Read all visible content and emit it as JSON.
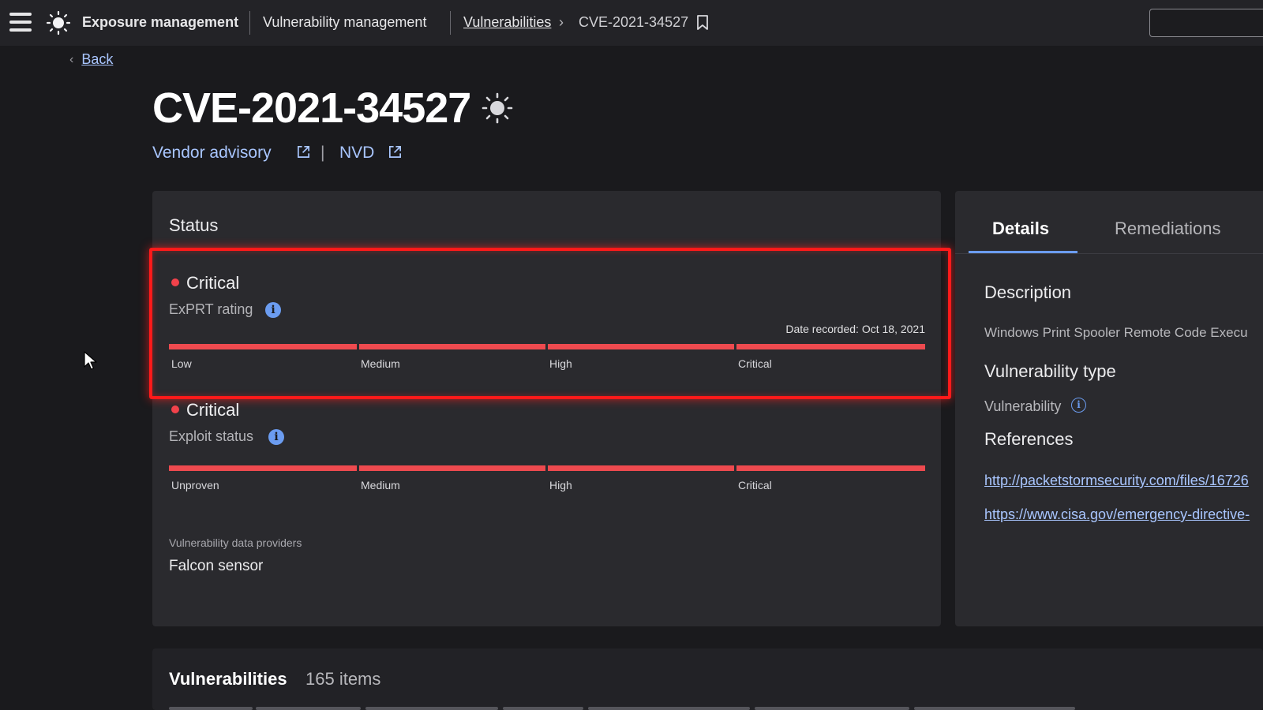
{
  "topbar": {
    "app_title": "Exposure management",
    "section": "Vulnerability management",
    "breadcrumb_link": "Vulnerabilities",
    "breadcrumb_current": "CVE-2021-34527"
  },
  "back_label": "Back",
  "cve": {
    "id": "CVE-2021-34527",
    "vendor_advisory": "Vendor advisory",
    "separator": "|",
    "nvd": "NVD"
  },
  "status": {
    "title": "Status",
    "exprt": {
      "level": "Critical",
      "label": "ExPRT rating",
      "date_recorded": "Date recorded: Oct 18, 2021",
      "scale": [
        "Low",
        "Medium",
        "High",
        "Critical"
      ]
    },
    "exploit": {
      "level": "Critical",
      "label": "Exploit status",
      "scale": [
        "Unproven",
        "Medium",
        "High",
        "Critical"
      ]
    },
    "providers_heading": "Vulnerability data providers",
    "providers_value": "Falcon sensor"
  },
  "details": {
    "tabs": [
      "Details",
      "Remediations"
    ],
    "description_heading": "Description",
    "description": "Windows Print Spooler Remote Code Execu",
    "vuln_type_heading": "Vulnerability type",
    "vuln_type": "Vulnerability",
    "references_heading": "References",
    "references": [
      "http://packetstormsecurity.com/files/16726",
      "https://www.cisa.gov/emergency-directive-"
    ]
  },
  "list": {
    "title": "Vulnerabilities",
    "count": "165 items"
  },
  "colors": {
    "critical": "#ee4a4f",
    "accent": "#a9c6ff",
    "highlight": "#ff1a1a"
  }
}
